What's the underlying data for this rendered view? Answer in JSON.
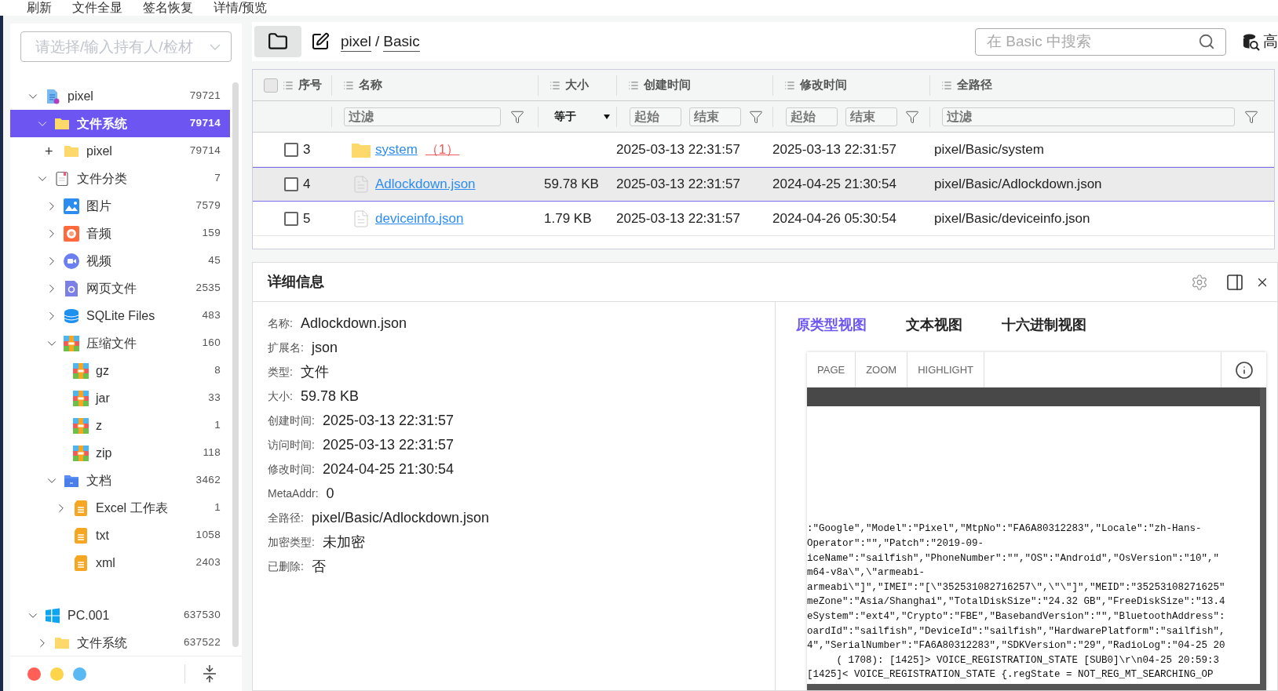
{
  "menu": [
    "刷新",
    "文件全显",
    "签名恢复",
    "详情/预览"
  ],
  "sidebar": {
    "owner_select": {
      "placeholder": "请选择/输入持有人/检材"
    },
    "tree": [
      {
        "label": "pixel",
        "count": "79721",
        "kind": "device",
        "expanded": true,
        "selected": false,
        "children": [
          {
            "label": "文件系统",
            "count": "79714",
            "kind": "folder",
            "expanded": true,
            "selected": true,
            "children": [
              {
                "label": "pixel",
                "count": "79714",
                "kind": "folder",
                "toggle": "+",
                "selected": false
              }
            ]
          },
          {
            "label": "文件分类",
            "count": "7",
            "kind": "clipboard",
            "expanded": true,
            "selected": false,
            "children": [
              {
                "label": "图片",
                "count": "7579",
                "kind": "image",
                "expanded": false,
                "selected": false
              },
              {
                "label": "音频",
                "count": "159",
                "kind": "audio",
                "expanded": false,
                "selected": false
              },
              {
                "label": "视频",
                "count": "45",
                "kind": "video",
                "expanded": false,
                "selected": false
              },
              {
                "label": "网页文件",
                "count": "2535",
                "kind": "web",
                "expanded": false,
                "selected": false
              },
              {
                "label": "SQLite Files",
                "count": "483",
                "kind": "database",
                "expanded": false,
                "selected": false
              },
              {
                "label": "压缩文件",
                "count": "160",
                "kind": "archive",
                "expanded": true,
                "selected": false,
                "children": [
                  {
                    "label": "gz",
                    "count": "8",
                    "kind": "archive",
                    "selected": false
                  },
                  {
                    "label": "jar",
                    "count": "33",
                    "kind": "archive",
                    "selected": false
                  },
                  {
                    "label": "z",
                    "count": "1",
                    "kind": "archive",
                    "selected": false
                  },
                  {
                    "label": "zip",
                    "count": "118",
                    "kind": "archive",
                    "selected": false
                  }
                ]
              },
              {
                "label": "文档",
                "count": "3462",
                "kind": "docs",
                "expanded": true,
                "selected": false,
                "children": [
                  {
                    "label": "Excel 工作表",
                    "count": "1",
                    "kind": "doc",
                    "expanded": false,
                    "selected": false
                  },
                  {
                    "label": "txt",
                    "count": "1058",
                    "kind": "doc",
                    "selected": false
                  },
                  {
                    "label": "xml",
                    "count": "2403",
                    "kind": "doc",
                    "selected": false
                  }
                ]
              }
            ]
          }
        ]
      },
      {
        "label": "PC.001",
        "count": "637530",
        "kind": "windows",
        "expanded": true,
        "selected": false,
        "children": [
          {
            "label": "文件系统",
            "count": "637522",
            "kind": "folder",
            "expanded": false,
            "selected": false
          }
        ]
      }
    ],
    "theme_dots": [
      {
        "color": "#ff5f57"
      },
      {
        "color": "#fed54a"
      },
      {
        "color": "#5ab8f5"
      }
    ]
  },
  "toolbar": {
    "breadcrumb": [
      "pixel",
      "Basic"
    ],
    "separator": "/",
    "search": {
      "placeholder": "在 Basic 中搜索"
    },
    "advanced": "高"
  },
  "table": {
    "columns": [
      "序号",
      "名称",
      "大小",
      "创建时间",
      "修改时间",
      "全路径"
    ],
    "select_all_checked": false,
    "filters": {
      "name": {
        "placeholder": "过滤"
      },
      "size": "等于",
      "created_from": {
        "placeholder": "起始"
      },
      "created_to": {
        "placeholder": "结束"
      },
      "modified_from": {
        "placeholder": "起始"
      },
      "modified_to": {
        "placeholder": "结束"
      },
      "path": {
        "placeholder": "过滤"
      }
    },
    "rows": [
      {
        "index": "3",
        "kind": "folder",
        "name": "system",
        "count": "（1）",
        "size": "",
        "created": "2025-03-13 22:31:57",
        "modified": "2025-03-13 22:31:57",
        "path": "pixel/Basic/system",
        "checked": false,
        "selected": false
      },
      {
        "index": "4",
        "kind": "file",
        "name": "Adlockdown.json",
        "size": "59.78 KB",
        "created": "2025-03-13 22:31:57",
        "modified": "2024-04-25 21:30:54",
        "path": "pixel/Basic/Adlockdown.json",
        "checked": false,
        "selected": true
      },
      {
        "index": "5",
        "kind": "file",
        "name": "deviceinfo.json",
        "size": "1.79 KB",
        "created": "2025-03-13 22:31:57",
        "modified": "2024-04-26 05:30:54",
        "path": "pixel/Basic/deviceinfo.json",
        "checked": false,
        "selected": false
      }
    ]
  },
  "details": {
    "title": "详细信息",
    "properties": [
      {
        "label": "名称:",
        "value": "Adlockdown.json"
      },
      {
        "label": "扩展名:",
        "value": "json"
      },
      {
        "label": "类型:",
        "value": "文件"
      },
      {
        "label": "大小:",
        "value": "59.78 KB"
      },
      {
        "label": "创建时间:",
        "value": "2025-03-13 22:31:57"
      },
      {
        "label": "访问时间:",
        "value": "2025-03-13 22:31:57"
      },
      {
        "label": "修改时间:",
        "value": "2024-04-25 21:30:54"
      },
      {
        "label": "MetaAddr:",
        "value": "0"
      },
      {
        "label": "全路径:",
        "value": "pixel/Basic/Adlockdown.json"
      },
      {
        "label": "加密类型:",
        "value": "未加密"
      },
      {
        "label": "已删除:",
        "value": "否"
      }
    ],
    "view_tabs": [
      {
        "label": "原类型视图",
        "selected": true
      },
      {
        "label": "文本视图",
        "selected": false
      },
      {
        "label": "十六进制视图",
        "selected": false
      }
    ],
    "viewer": {
      "buttons": [
        "PAGE",
        "ZOOM",
        "HIGHLIGHT"
      ],
      "lines": [
        ":\"Google\",\"Model\":\"Pixel\",\"MtpNo\":\"FA6A80312283\",\"Locale\":\"zh-Hans-",
        "Operator\":\"\",\"Patch\":\"2019-09-",
        "iceName\":\"sailfish\",\"PhoneNumber\":\"\",\"OS\":\"Android\",\"OsVersion\":\"10\",\"",
        "m64-v8a\\\",\\\"armeabi-",
        "armeabi\\\"]\",\"IMEI\":\"[\\\"352531082716257\\\",\\\"\\\"]\",\"MEID\":\"35253108271625\"",
        "meZone\":\"Asia/Shanghai\",\"TotalDiskSize\":\"24.32 GB\",\"FreeDiskSize\":\"13.4",
        "eSystem\":\"ext4\",\"Crypto\":\"FBE\",\"BasebandVersion\":\"\",\"BluetoothAddress\":",
        "oardId\":\"sailfish\",\"DeviceId\":\"sailfish\",\"HardwarePlatform\":\"sailfish\",",
        "4\",\"SerialNumber\":\"FA6A80312283\",\"SDKVersion\":\"29\",\"RadioLog\":\"04-25 20",
        "     ( 1708): [1425]> VOICE_REGISTRATION_STATE [SUB0]\\r\\n04-25 20:59:3",
        "[1425]< VOICE_REGISTRATION_STATE {.regState = NOT_REG_MT_SEARCHING_OP"
      ]
    }
  }
}
